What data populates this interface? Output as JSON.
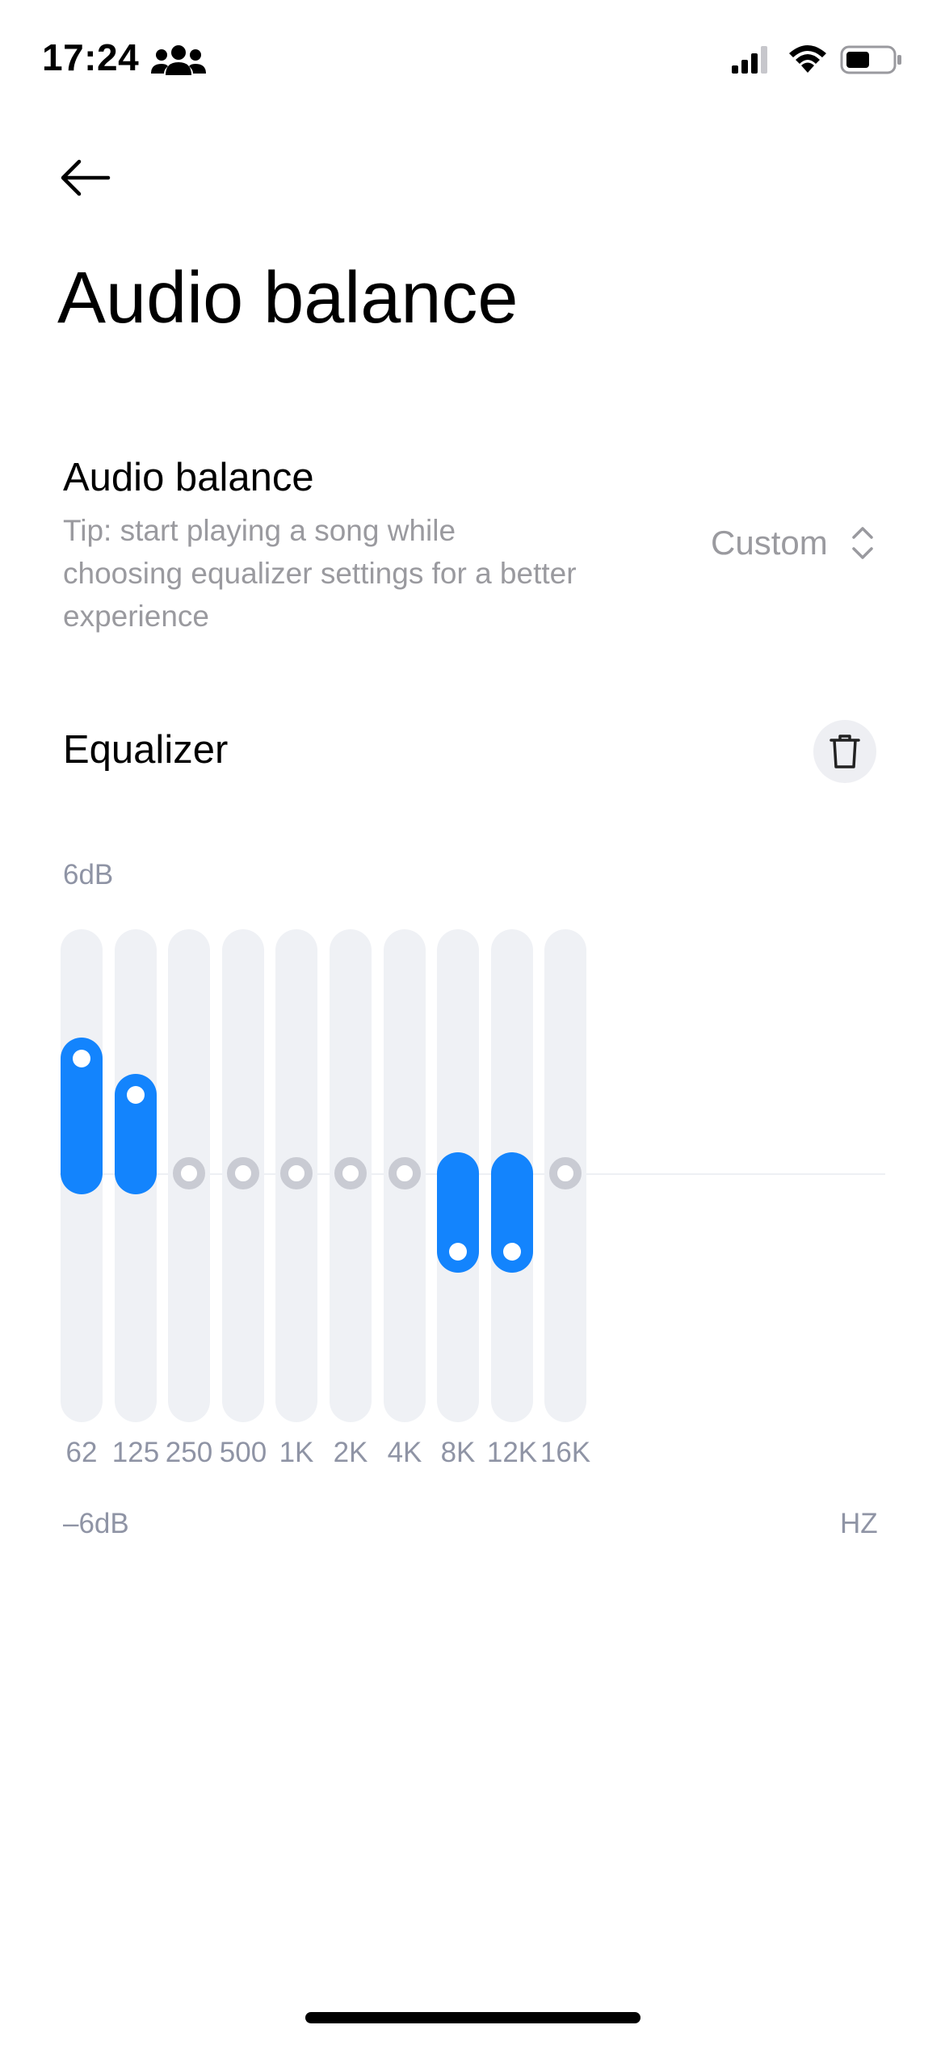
{
  "status_bar": {
    "time": "17:24",
    "icons": [
      "people-icon",
      "signal-icon",
      "wifi-icon",
      "battery-icon"
    ]
  },
  "header": {
    "back_icon": "arrow-left-icon",
    "title": "Audio balance"
  },
  "audio_balance": {
    "title": "Audio balance",
    "tip": "Tip: start playing a song while choosing equalizer settings for a better experience",
    "preset_value": "Custom",
    "preset_icon": "chevron-up-down-icon"
  },
  "equalizer": {
    "title": "Equalizer",
    "reset_icon": "trash-icon",
    "max_label": "6dB",
    "min_label": "–6dB",
    "unit_label": "HZ",
    "range_db": [
      -6,
      6
    ],
    "bands": [
      {
        "label": "62",
        "gain_db": 2.8
      },
      {
        "label": "125",
        "gain_db": 1.9
      },
      {
        "label": "250",
        "gain_db": 0
      },
      {
        "label": "500",
        "gain_db": 0
      },
      {
        "label": "1K",
        "gain_db": 0
      },
      {
        "label": "2K",
        "gain_db": 0
      },
      {
        "label": "4K",
        "gain_db": 0
      },
      {
        "label": "8K",
        "gain_db": -1.9
      },
      {
        "label": "12K",
        "gain_db": -1.9
      },
      {
        "label": "16K",
        "gain_db": 0
      }
    ]
  },
  "colors": {
    "accent": "#1384fd",
    "track": "#eff1f5",
    "label_gray": "#8f94a5",
    "tip_gray": "#9a9a9f"
  }
}
